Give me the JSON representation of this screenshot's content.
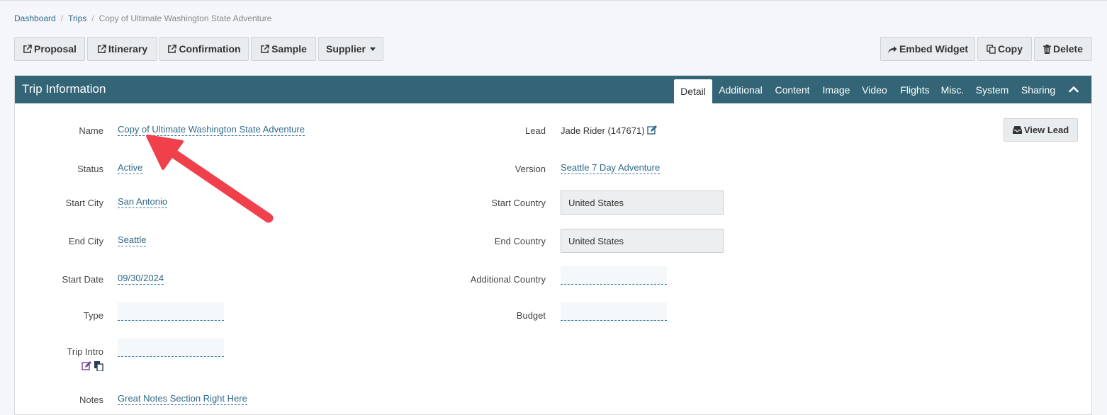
{
  "breadcrumb": [
    "Dashboard",
    "Trips",
    "Copy of Ultimate Washington State Adventure"
  ],
  "toolbar": {
    "proposal": "Proposal",
    "itinerary": "Itinerary",
    "confirmation": "Confirmation",
    "sample": "Sample",
    "supplier": "Supplier",
    "embed_widget": "Embed Widget",
    "copy": "Copy",
    "delete": "Delete"
  },
  "card": {
    "title": "Trip Information",
    "tabs": [
      "Detail",
      "Additional",
      "Content",
      "Image",
      "Video",
      "Flights",
      "Misc.",
      "System",
      "Sharing"
    ],
    "active_tab": "Detail"
  },
  "fields": {
    "name": {
      "label": "Name",
      "value": "Copy of Ultimate Washington State Adventure"
    },
    "status": {
      "label": "Status",
      "value": "Active"
    },
    "start_city": {
      "label": "Start City",
      "value": "San Antonio"
    },
    "end_city": {
      "label": "End City",
      "value": "Seattle"
    },
    "start_date": {
      "label": "Start Date",
      "value": "09/30/2024"
    },
    "type": {
      "label": "Type",
      "value": ""
    },
    "trip_intro": {
      "label": "Trip Intro",
      "value": ""
    },
    "notes": {
      "label": "Notes",
      "value": "Great Notes Section Right Here"
    },
    "lead": {
      "label": "Lead",
      "value": "Jade Rider (147671)"
    },
    "version": {
      "label": "Version",
      "value": "Seattle 7 Day Adventure"
    },
    "start_country": {
      "label": "Start Country",
      "value": "United States"
    },
    "end_country": {
      "label": "End Country",
      "value": "United States"
    },
    "additional_country": {
      "label": "Additional Country",
      "value": ""
    },
    "budget": {
      "label": "Budget",
      "value": ""
    }
  },
  "view_lead": "View Lead",
  "colors": {
    "header": "#336577",
    "link": "#2f6a89",
    "annotation_arrow": "#f0404c"
  }
}
